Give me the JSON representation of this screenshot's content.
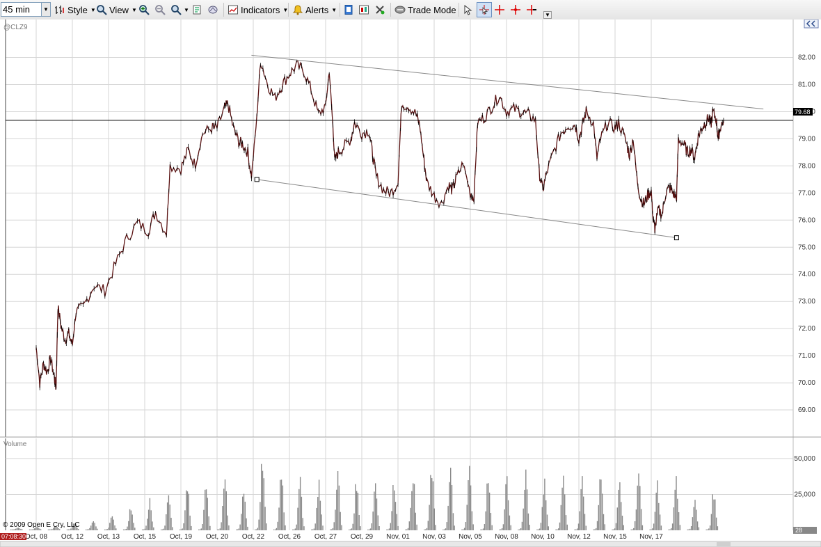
{
  "toolbar": {
    "interval": "45 min",
    "style_label": "Style",
    "view_label": "View",
    "indicators_label": "Indicators",
    "alerts_label": "Alerts",
    "trade_mode_label": "Trade Mode"
  },
  "symbol": "@CLZ9",
  "volume_panel_label": "Volume",
  "copyright": "© 2009 Open E Cry, LLC",
  "time_badge": "07:08:30",
  "last_price_label": "79.68",
  "volume_last_label": "28",
  "colors": {
    "candle": "#5a1212",
    "trendline": "#888888",
    "grid": "#d6d6d6",
    "price_badge": "#000000",
    "time_badge": "#b02020"
  },
  "chart_data": [
    {
      "type": "line",
      "title": "@CLZ9",
      "ylim": [
        68,
        83.4
      ],
      "yticks": [
        69,
        70,
        71,
        72,
        73,
        74,
        75,
        76,
        77,
        78,
        79,
        80,
        81,
        82
      ],
      "ytick_labels": [
        "69.00",
        "70.00",
        "71.00",
        "72.00",
        "73.00",
        "74.00",
        "75.00",
        "76.00",
        "77.00",
        "78.00",
        "79.00",
        "80.00",
        "81.00",
        "82.00"
      ],
      "grid": true,
      "last_price": 79.68,
      "categories": [
        "Oct, 08",
        "Oct, 12",
        "Oct, 13",
        "Oct, 15",
        "Oct, 19",
        "Oct, 20",
        "Oct, 22",
        "Oct, 26",
        "Oct, 27",
        "Oct, 29",
        "Nov, 01",
        "Nov, 03",
        "Nov, 05",
        "Nov, 08",
        "Nov, 10",
        "Nov, 12",
        "Nov, 15",
        "Nov, 17"
      ],
      "series": [
        {
          "points": [
            [
              0,
              71.3
            ],
            [
              0.1,
              70.0
            ],
            [
              0.2,
              70.7
            ],
            [
              0.3,
              70.4
            ],
            [
              0.4,
              70.9
            ],
            [
              0.5,
              70.2
            ],
            [
              0.55,
              69.8
            ],
            [
              0.6,
              72.8
            ],
            [
              0.7,
              72.0
            ],
            [
              0.8,
              71.6
            ],
            [
              0.9,
              71.8
            ],
            [
              1.0,
              71.4
            ],
            [
              1.1,
              72.6
            ],
            [
              1.3,
              72.8
            ],
            [
              1.6,
              73.6
            ],
            [
              1.9,
              73.4
            ],
            [
              2.2,
              74.4
            ],
            [
              2.5,
              75.3
            ],
            [
              2.8,
              75.9
            ],
            [
              3.1,
              75.6
            ],
            [
              3.3,
              76.3
            ],
            [
              3.6,
              75.5
            ],
            [
              3.7,
              78.0
            ],
            [
              4.0,
              77.9
            ],
            [
              4.2,
              78.6
            ],
            [
              4.4,
              78.0
            ],
            [
              4.6,
              79.2
            ],
            [
              4.85,
              79.4
            ],
            [
              5.0,
              79.4
            ],
            [
              5.2,
              80.1
            ],
            [
              5.3,
              80.3
            ],
            [
              5.45,
              79.4
            ],
            [
              5.6,
              78.9
            ],
            [
              5.7,
              78.8
            ],
            [
              5.85,
              78.5
            ],
            [
              5.95,
              77.6
            ],
            [
              6.1,
              79.8
            ],
            [
              6.2,
              81.9
            ],
            [
              6.4,
              81.0
            ],
            [
              6.6,
              80.5
            ],
            [
              6.8,
              81.0
            ],
            [
              7.0,
              81.4
            ],
            [
              7.2,
              81.7
            ],
            [
              7.4,
              81.5
            ],
            [
              7.6,
              80.8
            ],
            [
              7.8,
              79.9
            ],
            [
              8.0,
              80.2
            ],
            [
              8.1,
              81.5
            ],
            [
              8.2,
              79.5
            ],
            [
              8.25,
              78.2
            ],
            [
              8.35,
              78.5
            ],
            [
              8.5,
              78.7
            ],
            [
              8.7,
              79.0
            ],
            [
              8.8,
              79.6
            ],
            [
              9.0,
              79.2
            ],
            [
              9.2,
              79.3
            ],
            [
              9.3,
              78.4
            ],
            [
              9.4,
              77.6
            ],
            [
              9.6,
              77.1
            ],
            [
              9.8,
              77.0
            ],
            [
              10.0,
              77.4
            ],
            [
              10.1,
              80.3
            ],
            [
              10.3,
              80.2
            ],
            [
              10.5,
              79.9
            ],
            [
              10.6,
              79.5
            ],
            [
              10.7,
              78.4
            ],
            [
              10.8,
              77.4
            ],
            [
              11.0,
              76.9
            ],
            [
              11.2,
              76.6
            ],
            [
              11.4,
              77.3
            ],
            [
              11.5,
              77.1
            ],
            [
              11.6,
              77.5
            ],
            [
              11.8,
              78.1
            ],
            [
              12.0,
              77.0
            ],
            [
              12.1,
              76.8
            ],
            [
              12.2,
              79.6
            ],
            [
              12.4,
              79.8
            ],
            [
              12.6,
              80.2
            ],
            [
              12.8,
              80.6
            ],
            [
              13.0,
              80.0
            ],
            [
              13.2,
              80.1
            ],
            [
              13.4,
              80.0
            ],
            [
              13.6,
              79.9
            ],
            [
              13.8,
              79.7
            ],
            [
              13.9,
              77.8
            ],
            [
              14.0,
              77.1
            ],
            [
              14.1,
              77.7
            ],
            [
              14.3,
              78.5
            ],
            [
              14.5,
              79.2
            ],
            [
              14.7,
              79.5
            ],
            [
              14.9,
              79.5
            ],
            [
              15.0,
              79.0
            ],
            [
              15.1,
              79.5
            ],
            [
              15.2,
              80.0
            ],
            [
              15.4,
              79.6
            ],
            [
              15.5,
              78.3
            ],
            [
              15.6,
              79.0
            ],
            [
              15.8,
              79.6
            ],
            [
              16.0,
              79.4
            ],
            [
              16.1,
              79.6
            ],
            [
              16.3,
              78.9
            ],
            [
              16.4,
              78.4
            ],
            [
              16.5,
              79.0
            ],
            [
              16.6,
              77.6
            ],
            [
              16.7,
              76.8
            ],
            [
              16.8,
              76.6
            ],
            [
              16.9,
              76.9
            ],
            [
              17.0,
              77.1
            ],
            [
              17.05,
              76.0
            ],
            [
              17.1,
              75.7
            ],
            [
              17.2,
              76.4
            ],
            [
              17.3,
              76.2
            ],
            [
              17.4,
              77.0
            ],
            [
              17.5,
              77.2
            ],
            [
              17.6,
              77.0
            ],
            [
              17.7,
              76.8
            ],
            [
              17.75,
              79.0
            ],
            [
              17.9,
              78.8
            ],
            [
              18.0,
              78.5
            ],
            [
              18.1,
              78.6
            ],
            [
              18.2,
              78.3
            ],
            [
              18.3,
              79.1
            ],
            [
              18.4,
              79.4
            ],
            [
              18.5,
              79.6
            ],
            [
              18.6,
              79.8
            ],
            [
              18.65,
              79.5
            ],
            [
              18.7,
              80.0
            ],
            [
              18.8,
              79.7
            ],
            [
              18.85,
              79.0
            ],
            [
              18.9,
              79.4
            ],
            [
              19.0,
              79.68
            ]
          ]
        }
      ],
      "trendlines": [
        {
          "from": [
            5.95,
            82.08
          ],
          "to": [
            20.1,
            80.1
          ]
        },
        {
          "from": [
            6.1,
            77.5
          ],
          "to": [
            17.7,
            75.35
          ],
          "handles": true
        }
      ]
    },
    {
      "type": "bar",
      "title": "Volume",
      "ylim": [
        0,
        64000
      ],
      "yticks": [
        25000,
        50000
      ],
      "ytick_labels": [
        "25,000",
        "50,000"
      ],
      "session_peaks": [
        1500,
        2000,
        3000,
        5000,
        8000,
        12000,
        18000,
        22000,
        28000,
        35000,
        38000,
        40000,
        32000,
        55000,
        48000,
        37000,
        38000,
        45000,
        38000,
        38000,
        38000,
        45000,
        48000,
        45000,
        48000,
        40000,
        40000,
        45000,
        38000,
        45000,
        40000,
        48000,
        38000,
        47000,
        35000,
        40000,
        25000,
        30000
      ],
      "last_value": 28
    }
  ]
}
